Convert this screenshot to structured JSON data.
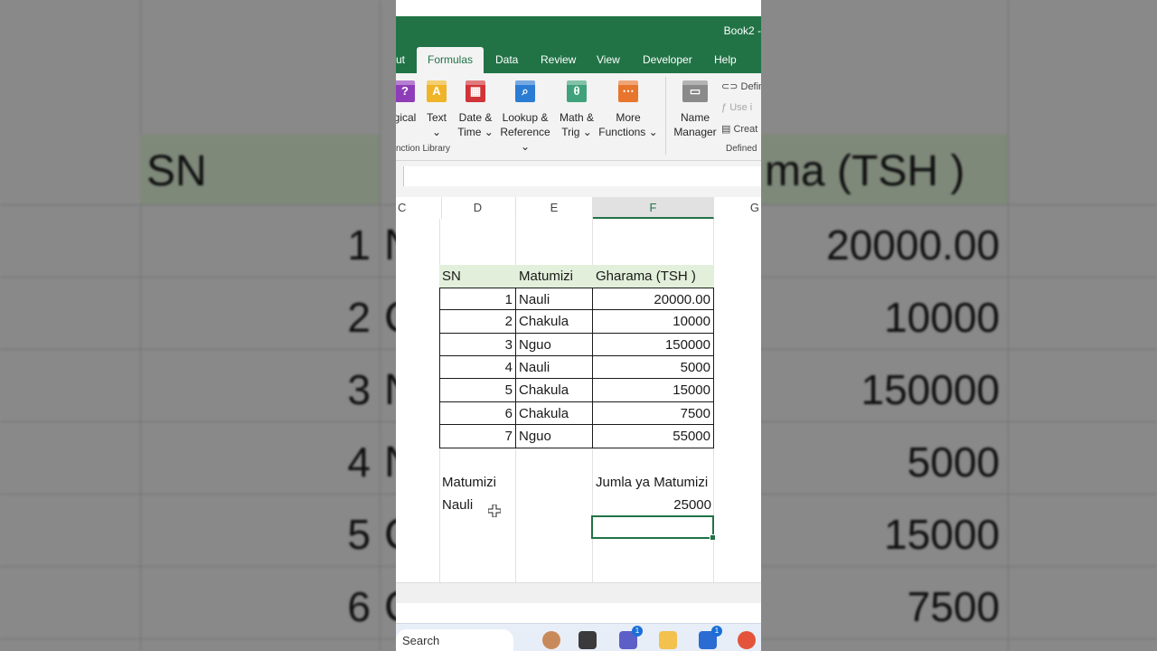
{
  "window": {
    "title": "Book2 -"
  },
  "ribbon": {
    "tabs": [
      {
        "label": "ut",
        "active": false
      },
      {
        "label": "Formulas",
        "active": true
      },
      {
        "label": "Data",
        "active": false
      },
      {
        "label": "Review",
        "active": false
      },
      {
        "label": "View",
        "active": false
      },
      {
        "label": "Developer",
        "active": false
      },
      {
        "label": "Help",
        "active": false
      }
    ],
    "buttons": [
      {
        "line1": "gical",
        "line2": "",
        "icon": "logical-icon",
        "color": "#8e3db8"
      },
      {
        "line1": "Text",
        "line2": "⌄",
        "icon": "text-function-icon",
        "color": "#f0b429"
      },
      {
        "line1": "Date &",
        "line2": "Time ⌄",
        "icon": "date-time-icon",
        "color": "#d13438"
      },
      {
        "line1": "Lookup &",
        "line2": "Reference ⌄",
        "icon": "lookup-reference-icon",
        "color": "#2b7cd3"
      },
      {
        "line1": "Math &",
        "line2": "Trig ⌄",
        "icon": "math-trig-icon",
        "color": "#3fa27c"
      },
      {
        "line1": "More",
        "line2": "Functions ⌄",
        "icon": "more-functions-icon",
        "color": "#e8752d"
      },
      {
        "line1": "Name",
        "line2": "Manager",
        "icon": "name-manager-icon",
        "color": "#8a8a8a"
      }
    ],
    "side_commands": [
      "Defin",
      "Use i",
      "Creat"
    ],
    "groups": {
      "function_library": "nction Library",
      "defined_names": "Defined"
    }
  },
  "sheet": {
    "column_headers": [
      "C",
      "D",
      "E",
      "F",
      "G"
    ],
    "selected_column": "F",
    "table": {
      "headers": [
        "SN",
        "Matumizi",
        "Gharama (TSH )"
      ],
      "rows": [
        [
          "1",
          "Nauli",
          "20000.00"
        ],
        [
          "2",
          "Chakula",
          "10000"
        ],
        [
          "3",
          "Nguo",
          "150000"
        ],
        [
          "4",
          "Nauli",
          "5000"
        ],
        [
          "5",
          "Chakula",
          "15000"
        ],
        [
          "6",
          "Chakula",
          "7500"
        ],
        [
          "7",
          "Nguo",
          "55000"
        ]
      ]
    },
    "summary": {
      "criteria_label": "Matumizi",
      "criteria_value": "Nauli",
      "result_label": "Jumla ya Matumizi",
      "result_value": "25000"
    }
  },
  "background": {
    "header_left": "SN",
    "header_right": "ma (TSH )",
    "sn": [
      "1",
      "2",
      "3",
      "4",
      "5",
      "6"
    ],
    "letters": [
      "N",
      "C",
      "N",
      "N",
      "C",
      "C"
    ],
    "values": [
      "20000.00",
      "10000",
      "150000",
      "5000",
      "15000",
      "7500"
    ]
  },
  "taskbar": {
    "search_placeholder": "Search",
    "badges": [
      "1",
      "1"
    ]
  }
}
